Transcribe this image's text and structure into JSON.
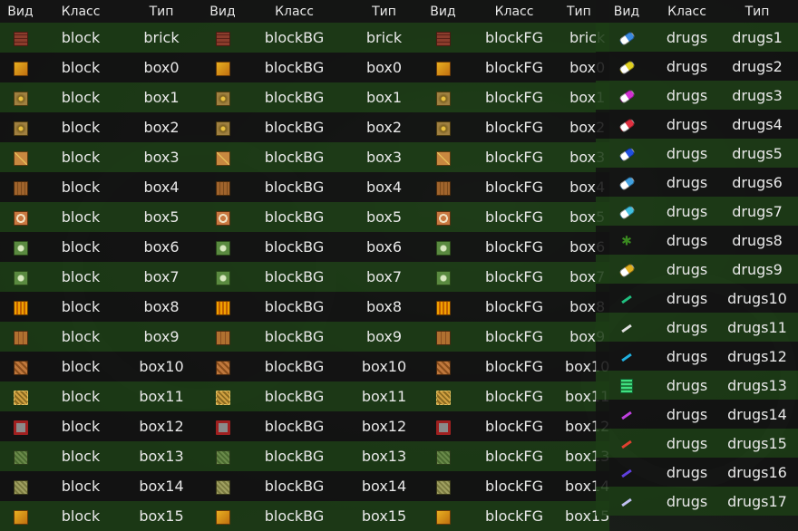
{
  "headers": {
    "view": "Вид",
    "class": "Класс",
    "type": "Тип"
  },
  "rows": [
    {
      "icon": "brick-icon",
      "cls": "i-brick",
      "type": "brick"
    },
    {
      "icon": "question-block-icon",
      "cls": "i-q",
      "type": "box0"
    },
    {
      "icon": "dotted-box-icon",
      "cls": "i-dot",
      "type": "box1"
    },
    {
      "icon": "dotted-box-icon",
      "cls": "i-dot",
      "type": "box2"
    },
    {
      "icon": "cross-box-icon",
      "cls": "i-x",
      "type": "box3"
    },
    {
      "icon": "crate-icon",
      "cls": "i-crate",
      "type": "box4"
    },
    {
      "icon": "round-emblem-box-icon",
      "cls": "i-round",
      "type": "box5"
    },
    {
      "icon": "green-emblem-box-icon",
      "cls": "i-green",
      "type": "box6"
    },
    {
      "icon": "green-emblem-box-icon",
      "cls": "i-green",
      "type": "box7"
    },
    {
      "icon": "striped-box-icon",
      "cls": "i-stripes",
      "type": "box8"
    },
    {
      "icon": "wooden-box-icon",
      "cls": "i-wood",
      "type": "box9"
    },
    {
      "icon": "diagonal-crate-icon",
      "cls": "i-diag",
      "type": "box10"
    },
    {
      "icon": "gold-pattern-box-icon",
      "cls": "i-gold",
      "type": "box11"
    },
    {
      "icon": "red-frame-box-icon",
      "cls": "i-red",
      "type": "box12"
    },
    {
      "icon": "moss-box-icon",
      "cls": "i-moss",
      "type": "box13"
    },
    {
      "icon": "olive-box-icon",
      "cls": "i-olive",
      "type": "box14"
    },
    {
      "icon": "question-block-icon",
      "cls": "i-q",
      "type": "box15"
    }
  ],
  "classes": [
    "block",
    "blockBG",
    "blockFG"
  ],
  "drugs": [
    {
      "icon": "pill-icon",
      "color": "#3a8ae0",
      "type": "drugs1"
    },
    {
      "icon": "pill-icon",
      "color": "#e0d020",
      "type": "drugs2"
    },
    {
      "icon": "pill-icon",
      "color": "#d030d0",
      "type": "drugs3"
    },
    {
      "icon": "pill-icon",
      "color": "#e03040",
      "type": "drugs4"
    },
    {
      "icon": "pill-icon",
      "color": "#2050e0",
      "type": "drugs5"
    },
    {
      "icon": "pill-icon",
      "color": "#40a0e0",
      "type": "drugs6"
    },
    {
      "icon": "pill-icon",
      "color": "#40c0e0",
      "type": "drugs7"
    },
    {
      "icon": "leaf-icon",
      "color": "#3a8a20",
      "type": "drugs8"
    },
    {
      "icon": "pill-icon",
      "color": "#e0b020",
      "type": "drugs9"
    },
    {
      "icon": "syringe-icon",
      "color": "#20c080",
      "type": "drugs10"
    },
    {
      "icon": "cigarette-icon",
      "color": "#e0e0e0",
      "type": "drugs11"
    },
    {
      "icon": "syringe-icon",
      "color": "#20b0e0",
      "type": "drugs12"
    },
    {
      "icon": "package-icon",
      "color": "#40e080",
      "type": "drugs13"
    },
    {
      "icon": "syringe-icon",
      "color": "#c040e0",
      "type": "drugs14"
    },
    {
      "icon": "syringe-icon",
      "color": "#e04030",
      "type": "drugs15"
    },
    {
      "icon": "syringe-icon",
      "color": "#6040e0",
      "type": "drugs16"
    },
    {
      "icon": "syringe-icon",
      "color": "#c0c0f0",
      "type": "drugs17"
    }
  ],
  "drugs_class": "drugs"
}
